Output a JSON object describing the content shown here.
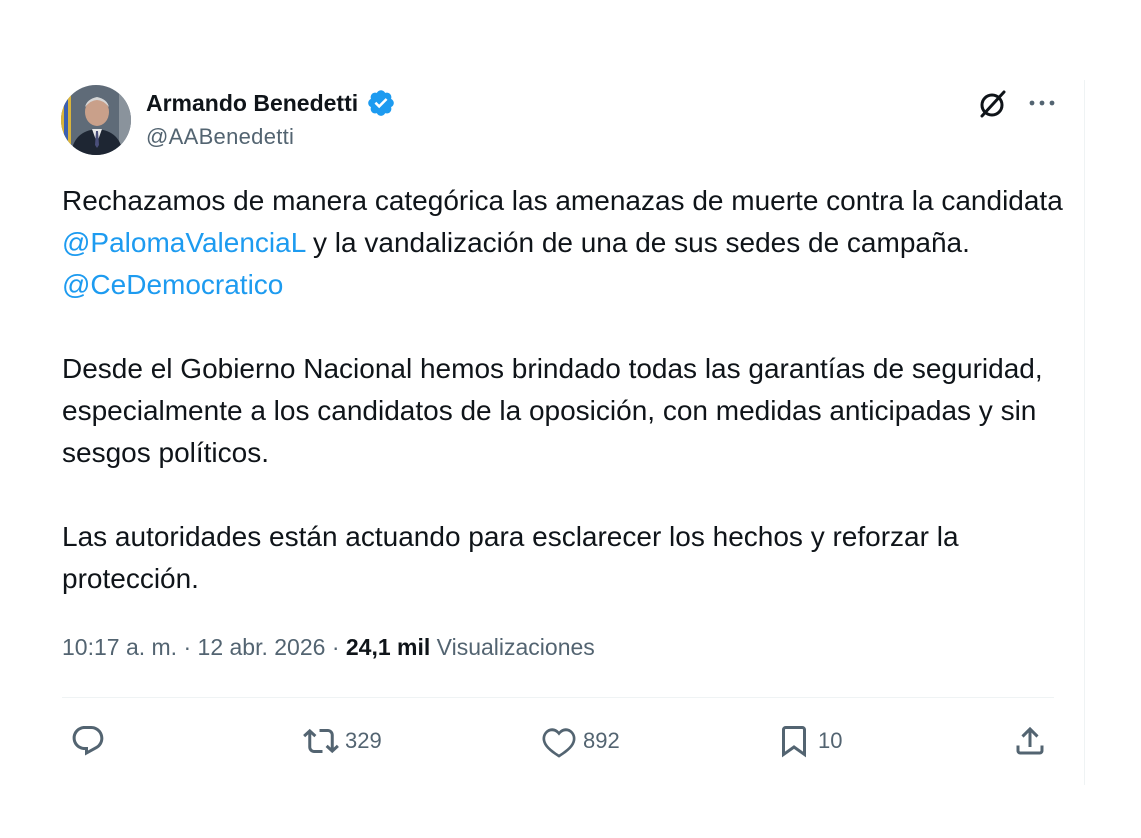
{
  "author": {
    "name": "Armando Benedetti",
    "handle": "@AABenedetti"
  },
  "tweet": {
    "paragraphs": [
      {
        "text_1": "Rechazamos de manera categórica las amenazas de muerte contra la candidata ",
        "mention_1": "@PalomaValenciaL",
        "text_2": " y la vandalización de una de sus sedes de campaña. ",
        "mention_2": "@CeDemocratico"
      },
      {
        "text": "Desde el Gobierno Nacional hemos brindado todas las garantías de seguridad, especialmente a los candidatos de la oposición, con medidas anticipadas y sin sesgos políticos."
      },
      {
        "text": "Las autoridades están actuando para esclarecer los hechos y reforzar la protección."
      }
    ]
  },
  "meta": {
    "time": "10:17 a. m.",
    "separator": " · ",
    "date": "12 abr. 2026",
    "views_count": "24,1 mil",
    "views_label": "Visualizaciones"
  },
  "actions": {
    "reply_count": "",
    "retweet_count": "329",
    "like_count": "892",
    "bookmark_count": "10"
  },
  "icons": {
    "verified": "verified-badge-icon",
    "grok": "grok-icon",
    "more": "more-options-icon",
    "reply": "reply-icon",
    "retweet": "retweet-icon",
    "like": "heart-icon",
    "bookmark": "bookmark-icon",
    "share": "share-icon"
  },
  "colors": {
    "accent": "#1d9bf0",
    "text": "#0f1419",
    "muted": "#536471"
  }
}
